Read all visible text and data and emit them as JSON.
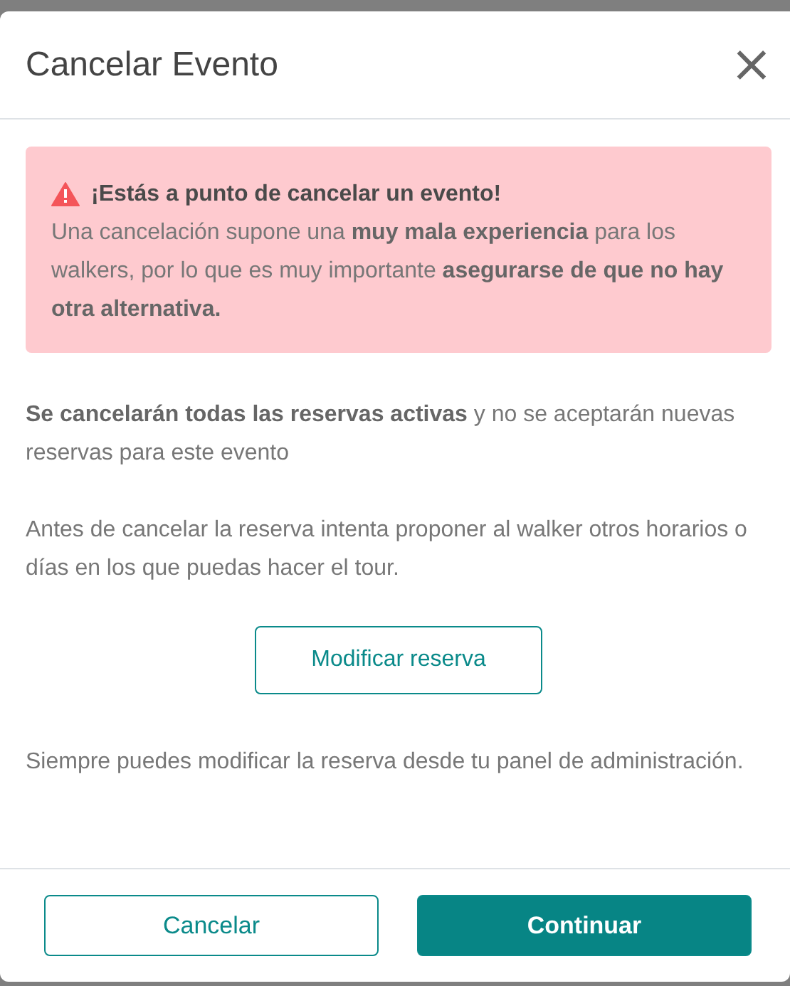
{
  "dialog": {
    "title": "Cancelar Evento",
    "close": "×"
  },
  "alert": {
    "title": "¡Estás a punto de cancelar un evento!",
    "body": "Una cancelación supone una **muy mala experiencia** para los walkers, por lo que es muy importante **asegurarse de que no hay otra alternativa.**"
  },
  "paragraphs": [
    "**Se cancelarán todas las reservas activas** y no se aceptarán nuevas reservas para este evento",
    "Antes de cancelar la reserva intenta proponer al walker otros horarios o días en los que puedas hacer el tour."
  ],
  "modify_button": "Modificar reserva",
  "note": "Siempre puedes modificar la reserva desde tu panel de administración.",
  "footer_buttons": [
    {
      "label": "Cancelar",
      "kind": "outline"
    },
    {
      "label": "Continuar",
      "kind": "primary"
    }
  ]
}
